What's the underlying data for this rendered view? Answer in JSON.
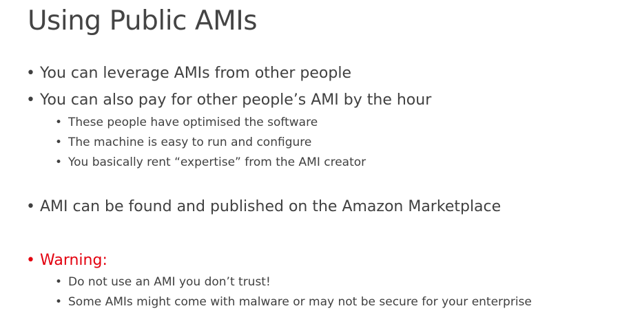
{
  "slide": {
    "title": "Using Public AMIs",
    "bullet_glyph": "•",
    "bullets": [
      {
        "text": "You can leverage AMIs from other people"
      },
      {
        "text": "You can also pay for other people’s AMI by the hour"
      },
      {
        "text": "These people have optimised the software"
      },
      {
        "text": "The machine is easy to run and configure"
      },
      {
        "text": "You basically rent “expertise” from the AMI creator"
      },
      {
        "text": "AMI can be found and published on the Amazon Marketplace"
      },
      {
        "text": "Warning:"
      },
      {
        "text": "Do not use an AMI you don’t trust!"
      },
      {
        "text": "Some AMIs might come with malware or may not be secure for your enterprise"
      }
    ],
    "colors": {
      "text": "#404040",
      "title": "#444444",
      "warning": "#e3000f",
      "background": "#ffffff"
    }
  }
}
